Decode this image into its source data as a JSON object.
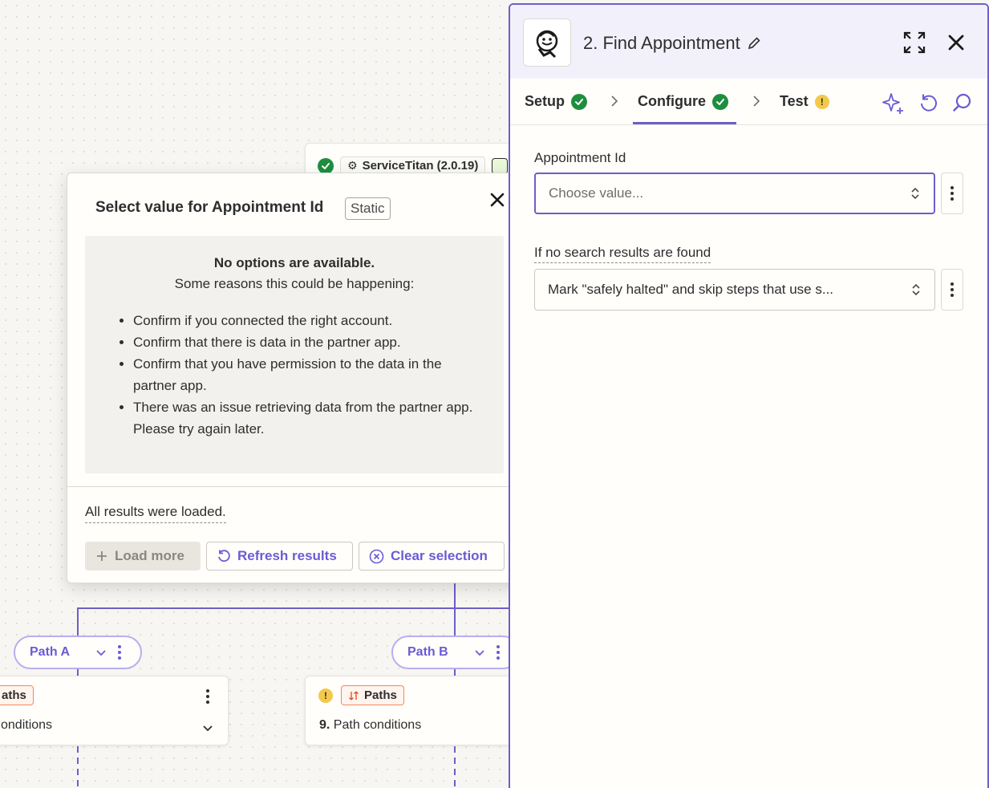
{
  "background_step": {
    "app_label": "ServiceTitan (2.0.19)"
  },
  "popover": {
    "title": "Select value for Appointment Id",
    "badge": "Static",
    "empty_heading": "No options are available.",
    "empty_subheading": "Some reasons this could be happening:",
    "reasons": [
      "Confirm if you connected the right account.",
      "Confirm that there is data in the partner app.",
      "Confirm that you have permission to the data in the partner app.",
      "There was an issue retrieving data from the partner app. Please try again later."
    ],
    "loaded_text": "All results were loaded.",
    "load_more_label": "Load more",
    "refresh_label": "Refresh results",
    "clear_label": "Clear selection"
  },
  "paths": {
    "path_a_label": "Path A",
    "path_b_label": "Path B",
    "card_a_chip": "aths",
    "card_a_text": "onditions",
    "card_b_chip": "Paths",
    "card_b_number": "9.",
    "card_b_text": "Path conditions"
  },
  "panel": {
    "title": "2. Find Appointment",
    "tabs": [
      {
        "label": "Setup",
        "status": "complete"
      },
      {
        "label": "Configure",
        "status": "complete"
      },
      {
        "label": "Test",
        "status": "warning"
      }
    ],
    "fields": {
      "appointment_id_label": "Appointment Id",
      "appointment_id_placeholder": "Choose value...",
      "no_results_label": "If no search results are found",
      "no_results_value": "Mark \"safely halted\" and skip steps that use s..."
    }
  },
  "colors": {
    "accent": "#6c5fc7",
    "success": "#1e8e3e",
    "warning": "#f2c94c",
    "paths_orange": "#f08a5d"
  }
}
